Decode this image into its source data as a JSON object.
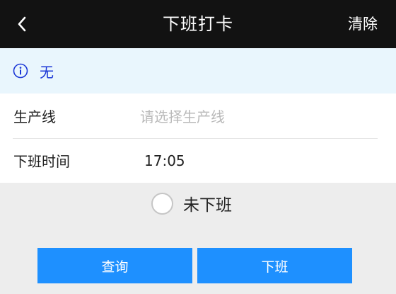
{
  "header": {
    "title": "下班打卡",
    "clear_label": "清除",
    "back_icon": "chevron-left-icon"
  },
  "notice": {
    "icon": "info-icon",
    "text": "无",
    "text_color": "#1a36d6",
    "background": "#e9f6fd"
  },
  "form": {
    "production_line": {
      "label": "生产线",
      "placeholder": "请选择生产线",
      "value": ""
    },
    "off_time": {
      "label": "下班时间",
      "value": "17:05"
    }
  },
  "status_option": {
    "label": "未下班",
    "checked": false
  },
  "buttons": {
    "query_label": "查询",
    "offwork_label": "下班",
    "color": "#1e90ff"
  }
}
